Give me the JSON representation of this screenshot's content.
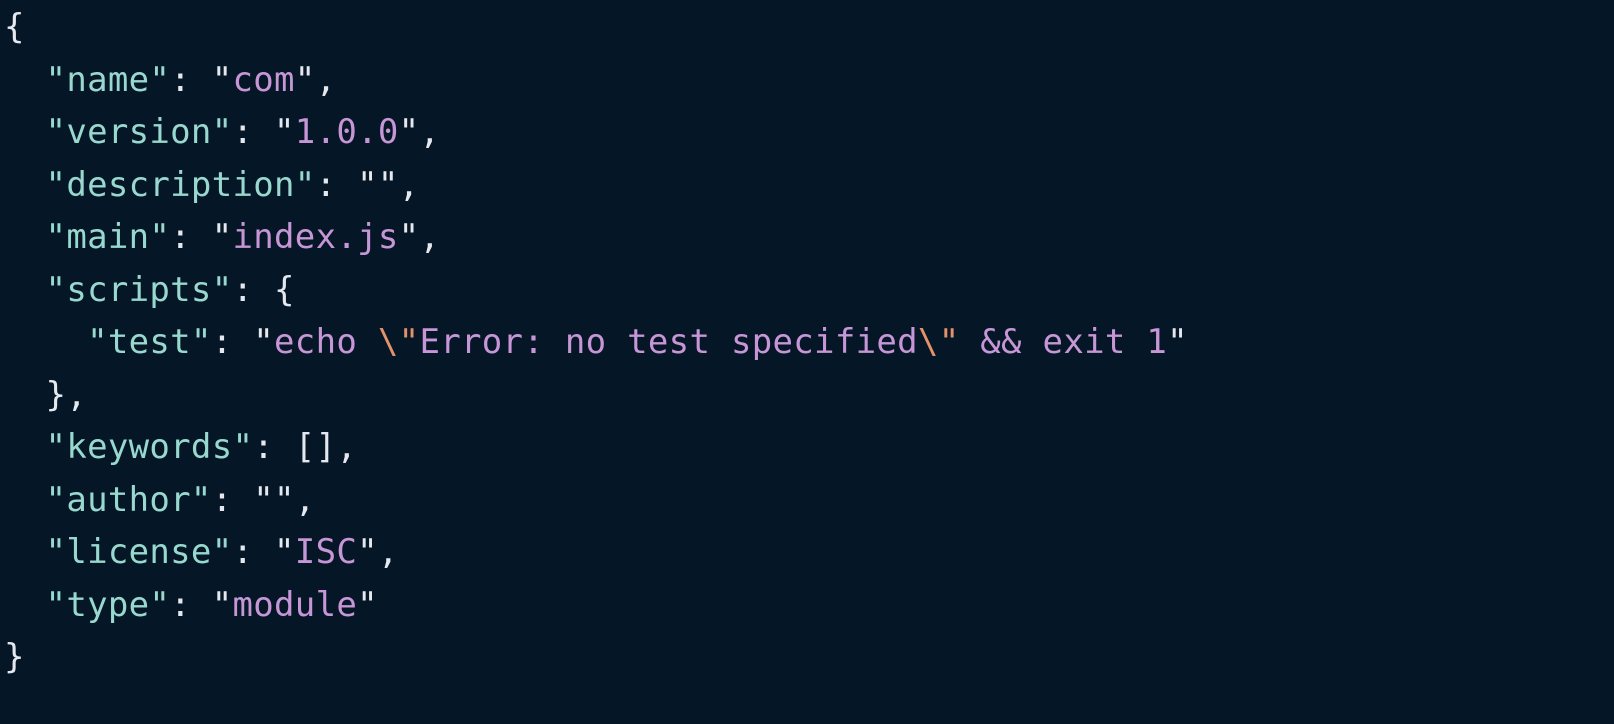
{
  "colors": {
    "background": "#051626",
    "punctuation": "#e5e9ef",
    "key": "#98d8ce",
    "string_value": "#c696d6",
    "escape": "#e5926a"
  },
  "lines": [
    [
      {
        "t": "{",
        "c": "p"
      }
    ],
    [
      {
        "t": "  ",
        "c": "p"
      },
      {
        "t": "\"name\"",
        "c": "k"
      },
      {
        "t": ": \"",
        "c": "p"
      },
      {
        "t": "com",
        "c": "v"
      },
      {
        "t": "\",",
        "c": "p"
      }
    ],
    [
      {
        "t": "  ",
        "c": "p"
      },
      {
        "t": "\"version\"",
        "c": "k"
      },
      {
        "t": ": \"",
        "c": "p"
      },
      {
        "t": "1.0.0",
        "c": "v"
      },
      {
        "t": "\",",
        "c": "p"
      }
    ],
    [
      {
        "t": "  ",
        "c": "p"
      },
      {
        "t": "\"description\"",
        "c": "k"
      },
      {
        "t": ": \"\",",
        "c": "p"
      }
    ],
    [
      {
        "t": "  ",
        "c": "p"
      },
      {
        "t": "\"main\"",
        "c": "k"
      },
      {
        "t": ": \"",
        "c": "p"
      },
      {
        "t": "index.js",
        "c": "v"
      },
      {
        "t": "\",",
        "c": "p"
      }
    ],
    [
      {
        "t": "  ",
        "c": "p"
      },
      {
        "t": "\"scripts\"",
        "c": "k"
      },
      {
        "t": ": {",
        "c": "p"
      }
    ],
    [
      {
        "t": "    ",
        "c": "p"
      },
      {
        "t": "\"test\"",
        "c": "k"
      },
      {
        "t": ": \"",
        "c": "p"
      },
      {
        "t": "echo ",
        "c": "v"
      },
      {
        "t": "\\\"",
        "c": "e"
      },
      {
        "t": "Error: no test specified",
        "c": "v"
      },
      {
        "t": "\\\"",
        "c": "e"
      },
      {
        "t": " && exit 1",
        "c": "v"
      },
      {
        "t": "\"",
        "c": "p"
      }
    ],
    [
      {
        "t": "  },",
        "c": "p"
      }
    ],
    [
      {
        "t": "  ",
        "c": "p"
      },
      {
        "t": "\"keywords\"",
        "c": "k"
      },
      {
        "t": ": [],",
        "c": "p"
      }
    ],
    [
      {
        "t": "  ",
        "c": "p"
      },
      {
        "t": "\"author\"",
        "c": "k"
      },
      {
        "t": ": \"\",",
        "c": "p"
      }
    ],
    [
      {
        "t": "  ",
        "c": "p"
      },
      {
        "t": "\"license\"",
        "c": "k"
      },
      {
        "t": ": \"",
        "c": "p"
      },
      {
        "t": "ISC",
        "c": "v"
      },
      {
        "t": "\",",
        "c": "p"
      }
    ],
    [
      {
        "t": "  ",
        "c": "p"
      },
      {
        "t": "\"type\"",
        "c": "k"
      },
      {
        "t": ": \"",
        "c": "p"
      },
      {
        "t": "module",
        "c": "v"
      },
      {
        "t": "\"",
        "c": "p"
      }
    ],
    [
      {
        "t": "}",
        "c": "p"
      }
    ]
  ]
}
